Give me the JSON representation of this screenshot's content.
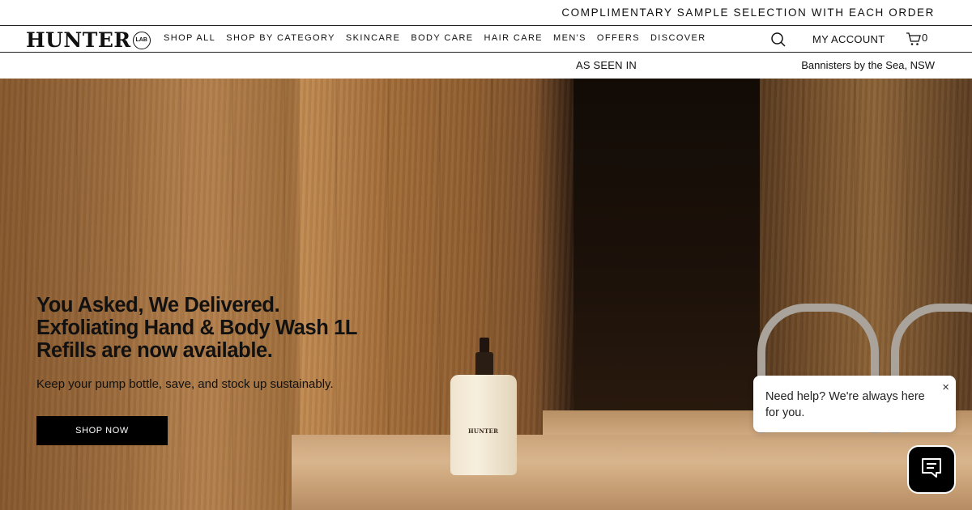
{
  "announcement": {
    "text": "COMPLIMENTARY SAMPLE SELECTION WITH EACH ORDER"
  },
  "header": {
    "logo": {
      "word": "HUNTER",
      "badge": "LAB"
    },
    "nav": [
      {
        "label": "SHOP ALL"
      },
      {
        "label": "SHOP BY CATEGORY"
      },
      {
        "label": "SKINCARE"
      },
      {
        "label": "BODY CARE"
      },
      {
        "label": "HAIR CARE"
      },
      {
        "label": "MEN'S"
      },
      {
        "label": "OFFERS"
      },
      {
        "label": "DISCOVER"
      }
    ],
    "search_icon": "search-icon",
    "account_label": "MY ACCOUNT",
    "cart_count": "0",
    "cart_icon": "cart-icon"
  },
  "subbar": {
    "seen_in": "AS SEEN IN",
    "location": "Bannisters by the Sea, NSW"
  },
  "hero": {
    "title_lines": [
      "You Asked, We Delivered.",
      "Exfoliating Hand & Body Wash 1L",
      "Refills are now available."
    ],
    "subtitle": "Keep your pump bottle, save, and stock up sustainably.",
    "cta_label": "SHOP NOW",
    "bottle_label": "HUNTER"
  },
  "chat": {
    "message": "Need help? We're always here for you.",
    "close_glyph": "×",
    "launcher_icon": "chat-icon"
  },
  "colors": {
    "text": "#111111",
    "button_bg": "#000000",
    "button_text": "#ffffff",
    "divider": "#222222"
  }
}
